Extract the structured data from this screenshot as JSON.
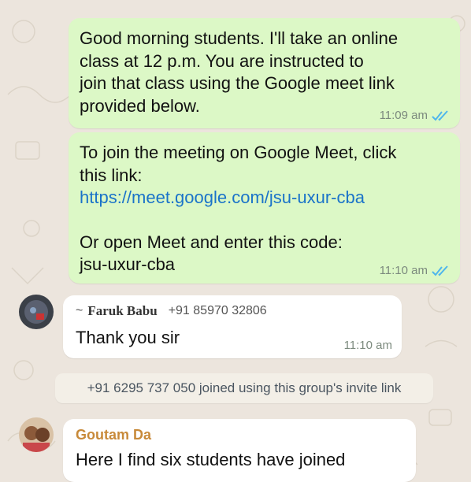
{
  "messages": {
    "msg1": {
      "text": "Good morning students. I'll take an online\nclass at 12 p.m. You are instructed to\njoin that class using the Google meet link\nprovided below.",
      "time": "11:09 am"
    },
    "msg2": {
      "intro": "To join the meeting on Google Meet, click\nthis link:",
      "link": "https://meet.google.com/jsu-uxur-cba",
      "outro": "Or open Meet and enter this code:\njsu-uxur-cba",
      "time": "11:10 am"
    },
    "msg3": {
      "sender_prefix": "~",
      "sender_name": "Faruk Babu",
      "sender_phone": "+91 85970 32806",
      "text": "Thank you sir",
      "time": "11:10 am"
    },
    "system": {
      "text": "+91 6295 737 050 joined using this group's invite link"
    },
    "msg4": {
      "sender_name": "Goutam Da",
      "text": "Here I find six students have joined"
    }
  },
  "icons": {
    "read_receipt": "double-check-icon"
  },
  "colors": {
    "background": "#ece5dd",
    "outgoing_bubble": "#dcf8c6",
    "incoming_bubble": "#ffffff",
    "read_tick": "#4fb6ec",
    "link": "#1a73c9",
    "sender_goutam": "#c88a3a",
    "sender_faruk_F": "#4fb6ec",
    "sender_faruk_B": "#4fb6ec"
  }
}
